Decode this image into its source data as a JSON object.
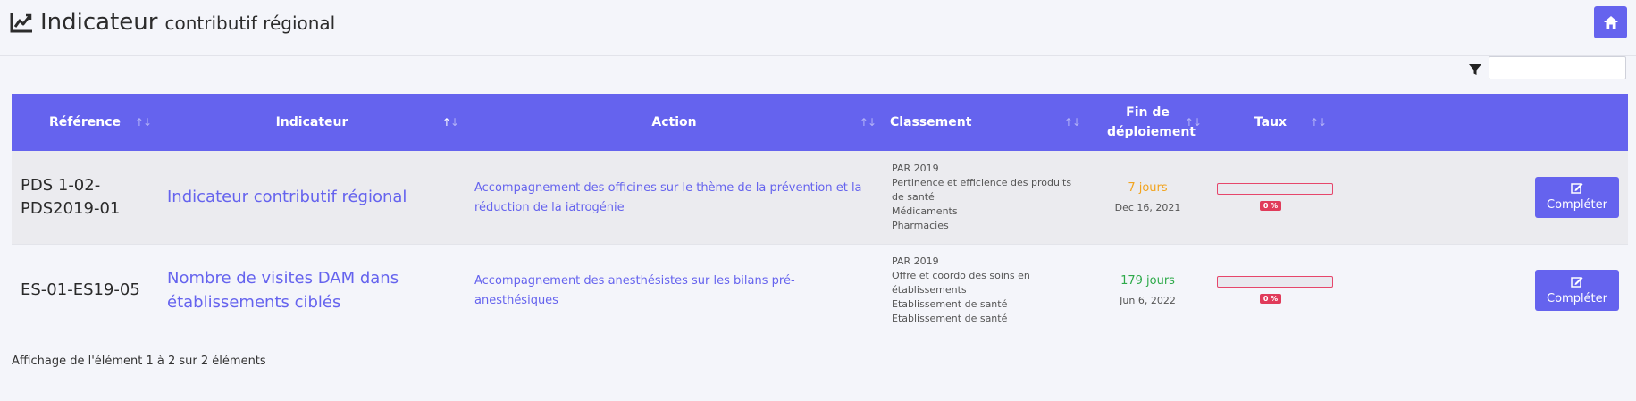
{
  "header": {
    "title_main": "Indicateur",
    "title_sub": "contributif régional",
    "title_icon": "line-chart-icon",
    "home_icon": "home-icon"
  },
  "filter": {
    "icon": "filter-icon",
    "value": ""
  },
  "table": {
    "columns": [
      "Référence",
      "Indicateur",
      "Action",
      "Classement",
      "Fin de déploiement",
      "Taux"
    ],
    "sort_icon": "↑↓",
    "rows": [
      {
        "reference": "PDS 1-02-PDS2019-01",
        "indicateur": "Indicateur contributif régional",
        "action": "Accompagnement des officines sur le thème de la prévention et la réduction de la iatrogénie",
        "classement": [
          "PAR 2019",
          "Pertinence et efficience des produits de santé",
          "Médicaments",
          "Pharmacies"
        ],
        "fin_days": "7 jours",
        "fin_days_color": "#f2a41f",
        "fin_date": "Dec 16, 2021",
        "taux_percent": 0,
        "taux_label": "0 %",
        "button": "Compléter"
      },
      {
        "reference": "ES-01-ES19-05",
        "indicateur": "Nombre de visites DAM dans établissements ciblés",
        "action": "Accompagnement des anesthésistes sur les bilans pré-anesthésiques",
        "classement": [
          "PAR 2019",
          "Offre et coordo des soins en établissements",
          "Etablissement de santé",
          "Etablissement de santé"
        ],
        "fin_days": "179 jours",
        "fin_days_color": "#2eaa4a",
        "fin_date": "Jun 6, 2022",
        "taux_percent": 0,
        "taux_label": "0 %",
        "button": "Compléter"
      }
    ]
  },
  "footer": {
    "info": "Affichage de l'élément 1 à 2 sur 2 éléments"
  },
  "colors": {
    "accent": "#6563ee",
    "danger": "#e6466b"
  }
}
